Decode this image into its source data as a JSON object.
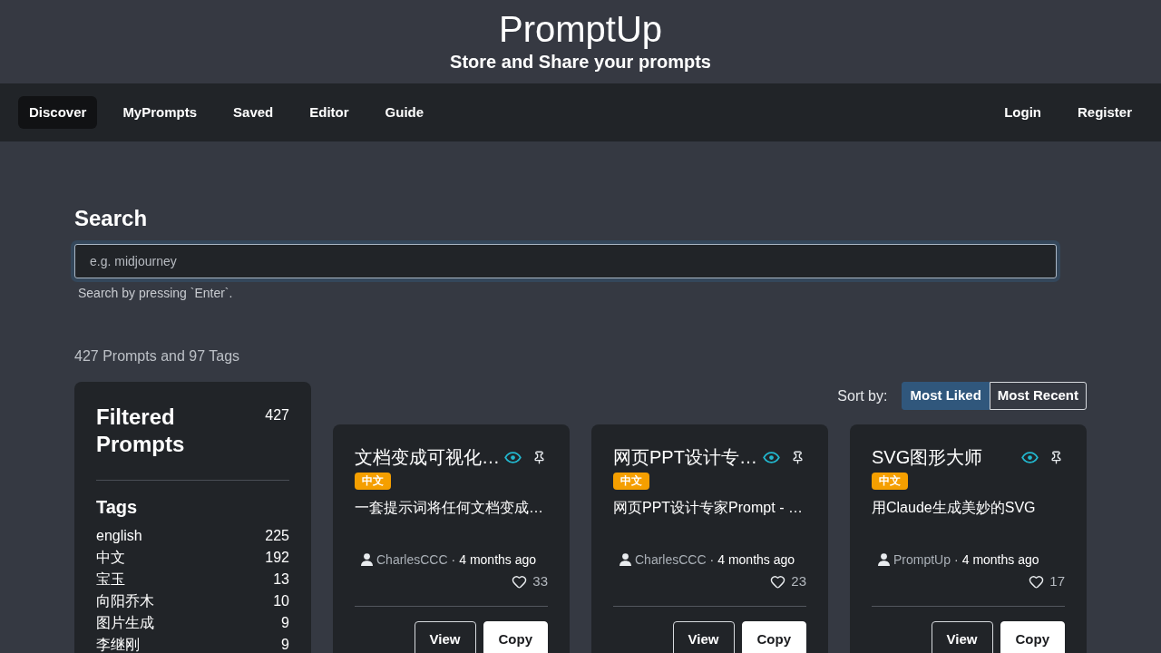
{
  "header": {
    "title": "PromptUp",
    "subtitle": "Store and Share your prompts"
  },
  "nav": {
    "items": [
      {
        "label": "Discover",
        "selected": true
      },
      {
        "label": "MyPrompts",
        "selected": false
      },
      {
        "label": "Saved",
        "selected": false
      },
      {
        "label": "Editor",
        "selected": false
      },
      {
        "label": "Guide",
        "selected": false
      }
    ],
    "account": [
      "Login",
      "Register"
    ]
  },
  "search": {
    "heading": "Search",
    "placeholder": "e.g. midjourney",
    "hint": "Search by pressing `Enter`."
  },
  "summary": "427 Prompts and 97 Tags",
  "sidebar": {
    "title": "Filtered Prompts",
    "count": "427",
    "tags_heading": "Tags",
    "tags": [
      {
        "label": "english",
        "count": "225"
      },
      {
        "label": "中文",
        "count": "192"
      },
      {
        "label": "宝玉",
        "count": "13"
      },
      {
        "label": "向阳乔木",
        "count": "10"
      },
      {
        "label": "图片生成",
        "count": "9"
      },
      {
        "label": "李继刚",
        "count": "9"
      }
    ]
  },
  "sort": {
    "label": "Sort by:",
    "options": [
      {
        "label": "Most Liked",
        "selected": true
      },
      {
        "label": "Most Recent",
        "selected": false
      }
    ]
  },
  "cards": [
    {
      "title": "文档变成可视化…",
      "tag": "中文",
      "description": "一套提示词将任何文档变成…",
      "author": "CharlesCCC",
      "separator": "·",
      "time": "4 months ago",
      "likes": "33",
      "actions": [
        {
          "label": "View",
          "kind": "outline"
        },
        {
          "label": "Copy",
          "kind": "solid"
        }
      ]
    },
    {
      "title": "网页PPT设计专…",
      "tag": "中文",
      "description": "网页PPT设计专家Prompt - …",
      "author": "CharlesCCC",
      "separator": "·",
      "time": "4 months ago",
      "likes": "23",
      "actions": [
        {
          "label": "View",
          "kind": "outline"
        },
        {
          "label": "Copy",
          "kind": "solid"
        }
      ]
    },
    {
      "title": "SVG图形大师",
      "tag": "中文",
      "description": "用Claude生成美妙的SVG",
      "author": "PromptUp",
      "separator": "·",
      "time": "4 months ago",
      "likes": "17",
      "actions": [
        {
          "label": "View",
          "kind": "outline"
        },
        {
          "label": "Copy",
          "kind": "solid"
        }
      ]
    }
  ]
}
